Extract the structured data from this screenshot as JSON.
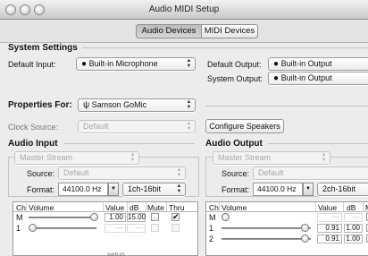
{
  "window": {
    "title": "Audio MIDI Setup"
  },
  "tabs": [
    "Audio Devices",
    "MIDI Devices"
  ],
  "system_settings": {
    "header": "System Settings",
    "default_input_label": "Default Input:",
    "default_input_value": "Built-in Microphone",
    "default_output_label": "Default Output:",
    "default_output_value": "Built-in Output",
    "system_output_label": "System Output:",
    "system_output_value": "Built-in Output"
  },
  "properties": {
    "label": "Properties For:",
    "device": "Samson GoMic",
    "clock_label": "Clock Source:",
    "clock_value": "Default",
    "configure_button": "Configure Speakers"
  },
  "audio_input": {
    "header": "Audio Input",
    "stream": "Master Stream",
    "source_label": "Source:",
    "source_value": "Default",
    "format_label": "Format:",
    "format_rate": "44100.0 Hz",
    "format_bits": "1ch-16bit",
    "columns": [
      "Ch",
      "Volume",
      "Value",
      "dB",
      "Mute",
      "Thru"
    ],
    "rows": [
      {
        "ch": "M",
        "value": "1.00",
        "db": "15.00",
        "mute": false,
        "thru": true
      },
      {
        "ch": "1",
        "value": "—",
        "db": "—",
        "mute": false,
        "thru": false
      }
    ]
  },
  "audio_output": {
    "header": "Audio Output",
    "stream": "Master Stream",
    "source_label": "Source:",
    "source_value": "Default",
    "format_label": "Format:",
    "format_rate": "44100.0 Hz",
    "format_bits": "2ch-16bit",
    "columns": [
      "Ch",
      "Volume",
      "Value",
      "dB",
      "M"
    ],
    "rows": [
      {
        "ch": "M",
        "value": "—",
        "db": "—",
        "mute": true
      },
      {
        "ch": "1",
        "value": "0.91",
        "db": "1.00",
        "mute": false
      },
      {
        "ch": "2",
        "value": "0.91",
        "db": "1.00",
        "mute": false
      }
    ]
  },
  "footer_text": "setup",
  "icons": {
    "apple": "apple-icon",
    "usb": "usb-icon"
  }
}
